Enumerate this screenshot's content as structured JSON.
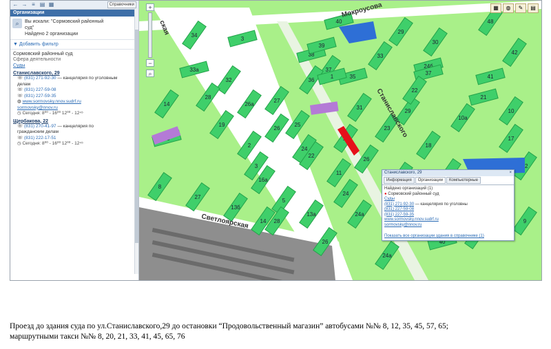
{
  "sidebar": {
    "toolbar_dropdown": "Справочники",
    "header": "Организации",
    "search_line1": "Вы искали: \"Сормовский районный",
    "search_line2": "суд\"",
    "search_found": "Найдено 2 организации",
    "add_filter": "Добавить фильтр",
    "org_name": "Сормовский районный суд",
    "activity_label": "Сфера деятельности",
    "activity_value": "Суды",
    "address1": {
      "title": "Станиславского, 29",
      "phone1": "(831) 271-92-30",
      "phone1_note": "— канцелярия по уголовным",
      "phone1_note2": "делам",
      "phone2": "(831) 227-59-08",
      "phone3": "(831) 227-59-35",
      "web": "www.sormovsky.nnov.sudrf.ru",
      "email": "sormovsky@nnov.ru",
      "hours": "Сегодня: 8⁰⁰ - 16⁰⁰   12⁰⁰ - 12⁴⁵"
    },
    "address2": {
      "title": "Щербакова, 22",
      "phone1": "(831) 270-41-97",
      "phone1_note": "— канцелярия по",
      "phone1_note2": "гражданским делам",
      "phone2": "(831) 222-17-51",
      "hours": "Сегодня: 8⁰⁰ - 16⁰⁰   12⁰⁰ - 12⁴⁵"
    }
  },
  "map": {
    "streets": {
      "mokrousova": "Мокроусова",
      "stanislavskogo": "Станиславского",
      "svetloyarskaya": "Светлоярская",
      "kaya": "ская"
    },
    "buildings": [
      "34",
      "3",
      "38",
      "39",
      "37",
      "40",
      "30",
      "48",
      "42",
      "33a",
      "32",
      "35",
      "36",
      "24б",
      "31",
      "29",
      "21",
      "28",
      "26a",
      "27",
      "14",
      "37",
      "22",
      "26",
      "25",
      "24",
      "19",
      "18",
      "17",
      "16a",
      "15",
      "10a",
      "8",
      "27",
      "13б",
      "14",
      "13a",
      "11",
      "24",
      "23",
      "12",
      "10",
      "9",
      "1",
      "2",
      "3",
      "5",
      "24a",
      "40",
      "24a",
      "26",
      "16",
      "8",
      "25",
      "26",
      "14",
      "41",
      "29",
      "33",
      "22",
      "28"
    ]
  },
  "popup": {
    "title": "Станиславского, 29",
    "tabs": [
      "Информация",
      "Организации",
      "Компьютерные"
    ],
    "found": "Найдено организаций (1)",
    "org": "Сормовский районный суд",
    "category": "Суды",
    "phone1": "(831) 271-92-30",
    "phone1_note": "— канцелярия по уголовны",
    "phone2": "(831) 227-59-08",
    "phone3": "(831) 227-59-35",
    "web": "www.sormovsky.nnov.sudrf.ru",
    "email": "sormovsky@nnov.ru",
    "show_all": "Показать все организации здания в справочнике (1)"
  },
  "caption": {
    "line1": "Проезд до здания суда по ул.Станиславского,29 до остановки “Продовольственный магазин” автобусами №№ 8, 12, 35, 45, 57, 65;",
    "line2": "маршрутными такси №№ 8, 20, 21, 33, 41, 45, 65, 76"
  },
  "colors": {
    "building": "#3fcf6a",
    "building_dark": "#23a24a",
    "map_bg": "#a9f089",
    "road": "#ffffff",
    "court": "#e6101a",
    "purple": "#b47ad6",
    "blue": "#2e6fd6",
    "industrial": "#8e8e8e"
  }
}
